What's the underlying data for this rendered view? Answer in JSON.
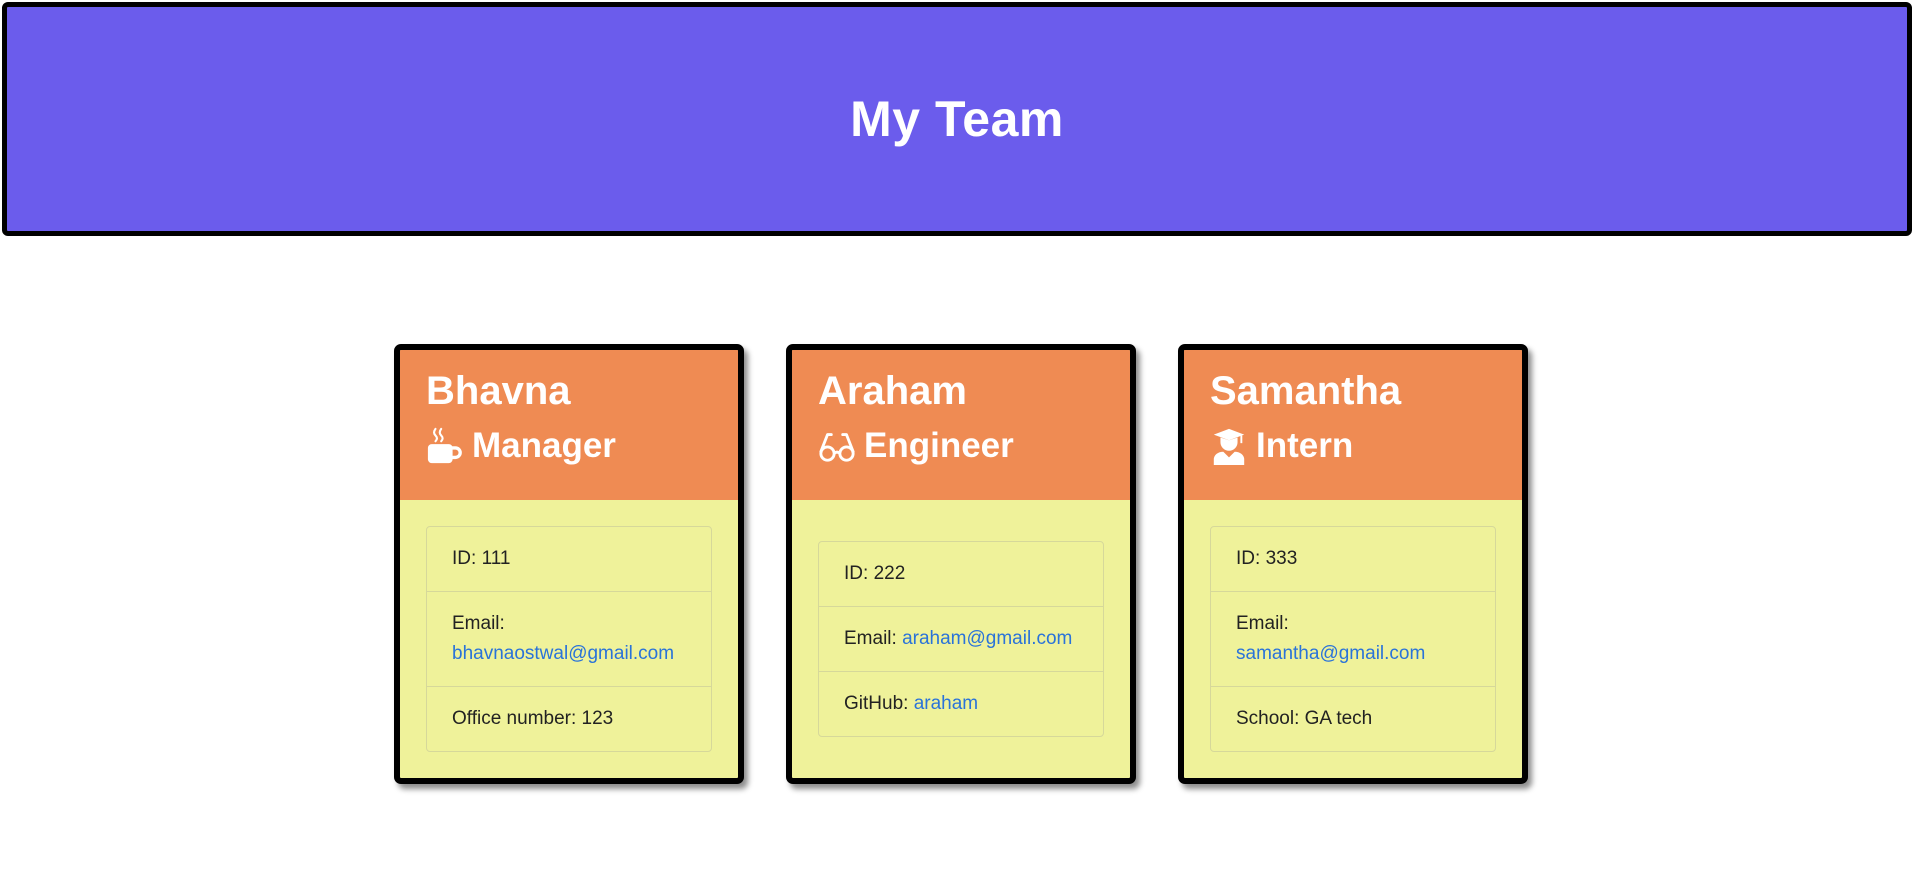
{
  "header": {
    "title": "My Team"
  },
  "team": [
    {
      "name": "Bhavna",
      "role": "Manager",
      "icon": "coffee-icon",
      "id_label": "ID:",
      "id": "111",
      "email_label": "Email:",
      "email": "bhavnaostwal@gmail.com",
      "extra_label": "Office number:",
      "extra_value": "123"
    },
    {
      "name": "Araham",
      "role": "Engineer",
      "icon": "glasses-icon",
      "id_label": "ID:",
      "id": "222",
      "email_label": "Email:",
      "email": "araham@gmail.com",
      "extra_label": "GitHub:",
      "extra_value": "araham"
    },
    {
      "name": "Samantha",
      "role": "Intern",
      "icon": "graduate-icon",
      "id_label": "ID:",
      "id": "333",
      "email_label": "Email:",
      "email": "samantha@gmail.com",
      "extra_label": "School:",
      "extra_value": "GA tech"
    }
  ],
  "colors": {
    "header_bg": "#6b5cec",
    "card_header_bg": "#ef8b53",
    "card_body_bg": "#eff29a",
    "link": "#2a73d9"
  }
}
